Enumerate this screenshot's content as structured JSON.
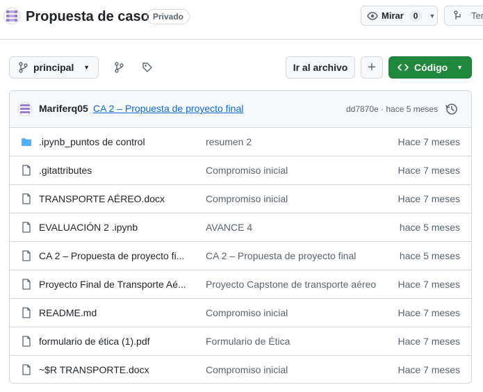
{
  "repo": {
    "title": "Propuesta de caso",
    "visibility": "Privado"
  },
  "header": {
    "watch_label": "Mirar",
    "watch_count": "0",
    "next_label": "Ten"
  },
  "toolbar": {
    "branch_label": "principal",
    "goto_file_label": "Ir al archivo",
    "add_label": "+",
    "code_label": "Código"
  },
  "commit": {
    "author": "Mariferq05",
    "message": "CA 2 – Propuesta de proyecto final",
    "meta": "dd7870e · hace 5 meses"
  },
  "files": [
    {
      "type": "folder",
      "name": ".ipynb_puntos de control",
      "message": "resumen 2",
      "date": "Hace 7 meses"
    },
    {
      "type": "file",
      "name": ".gitattributes",
      "message": "Compromiso inicial",
      "date": "Hace 7 meses"
    },
    {
      "type": "file",
      "name": "TRANSPORTE AÉREO.docx",
      "message": "Compromiso inicial",
      "date": "Hace 7 meses"
    },
    {
      "type": "file",
      "name": "EVALUACIÓN 2 .ipynb",
      "message": "AVANCE 4",
      "date": "hace 5 meses"
    },
    {
      "type": "file",
      "name": "CA 2 – Propuesta de proyecto fi...",
      "message": "CA 2 – Propuesta de proyecto final",
      "date": "hace 5 meses"
    },
    {
      "type": "file",
      "name": "Proyecto Final de Transporte Aé...",
      "message": "Proyecto Capstone de transporte aéreo",
      "date": "Hace 7 meses"
    },
    {
      "type": "file",
      "name": "README.md",
      "message": "Compromiso inicial",
      "date": "Hace 7 meses"
    },
    {
      "type": "file",
      "name": "formulario de ética (1).pdf",
      "message": "Formulario de Ética",
      "date": "Hace 7 meses"
    },
    {
      "type": "file",
      "name": "~$R TRANSPORTE.docx",
      "message": "Compromiso inicial",
      "date": "Hace 7 meses"
    }
  ],
  "colors": {
    "accent_green": "#1f883d",
    "link_blue": "#0969da",
    "folder_blue": "#54aeff",
    "muted": "#59636e",
    "border": "#d1d9e0"
  }
}
